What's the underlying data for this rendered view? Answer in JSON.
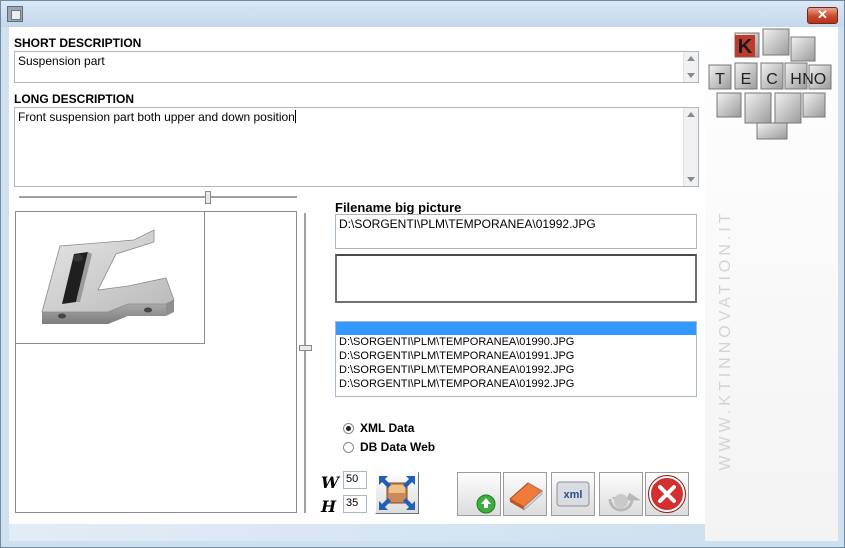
{
  "fields": {
    "short_label": "SHORT DESCRIPTION",
    "short_value": "Suspension part",
    "long_label": "LONG DESCRIPTION",
    "long_value": "Front suspension part both upper and down position",
    "filename_label": "Filename big picture",
    "filename_value": "D:\\SORGENTI\\PLM\\TEMPORANEA\\01992.JPG",
    "secondary_value": ""
  },
  "file_list": {
    "items": [
      "D:\\SORGENTI\\PLM\\TEMPORANEA\\01990.JPG",
      "D:\\SORGENTI\\PLM\\TEMPORANEA\\01991.JPG",
      "D:\\SORGENTI\\PLM\\TEMPORANEA\\01992.JPG",
      "D:\\SORGENTI\\PLM\\TEMPORANEA\\01992.JPG"
    ]
  },
  "data_source": {
    "xml_label": "XML Data",
    "db_label": "DB Data Web",
    "selected": "xml"
  },
  "size": {
    "w_label": "W",
    "w_value": "50",
    "h_label": "H",
    "h_value": "35"
  },
  "toolbar": {
    "xml_label": "xml",
    "icons": [
      "expand-image-icon",
      "upload-icon",
      "eraser-icon",
      "xml-export-icon",
      "recycle-icon",
      "close-circle-icon"
    ]
  },
  "branding": {
    "logo_letters": [
      "K",
      "T",
      "E",
      "C",
      "H",
      "N",
      "O"
    ],
    "url": "WWW.KTINNOVATION.IT"
  },
  "window": {
    "close_glyph": "✕"
  },
  "colors": {
    "list_selection": "#3399ff",
    "window_frame": "#cfe0ef",
    "logo_red": "#c0392b",
    "close_red": "#d32f2f"
  }
}
